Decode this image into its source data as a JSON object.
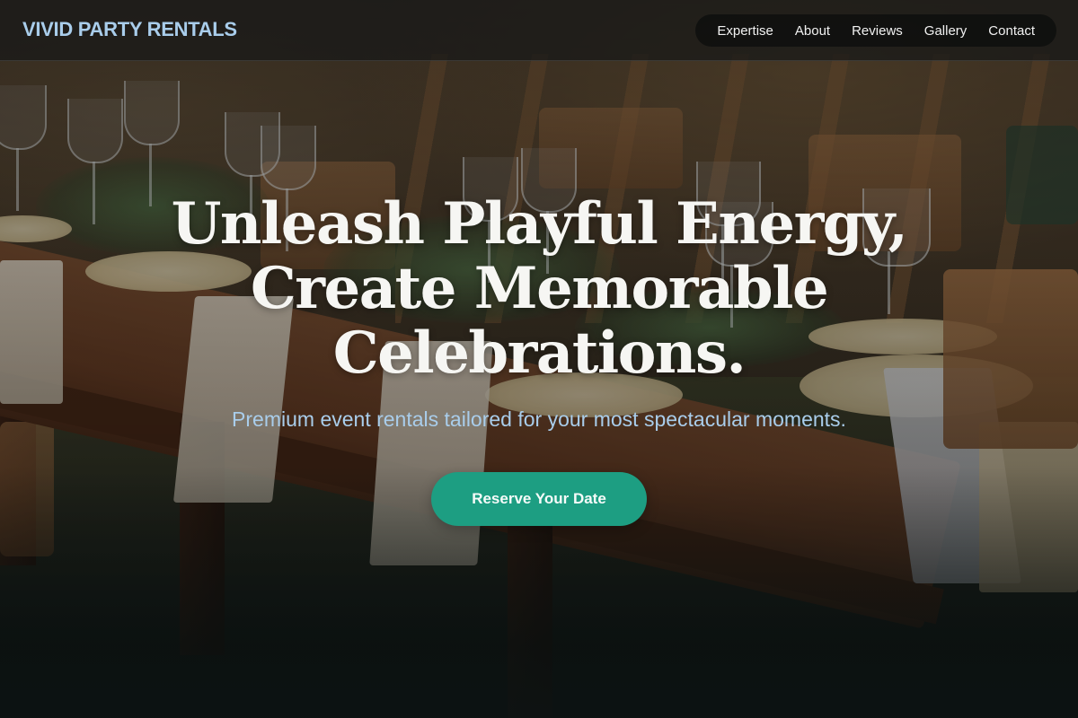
{
  "header": {
    "brand": "VIVID PARTY RENTALS",
    "nav": [
      "Expertise",
      "About",
      "Reviews",
      "Gallery",
      "Contact"
    ]
  },
  "hero": {
    "title": "Unleash Playful Energy,\nCreate Memorable\nCelebrations.",
    "subtitle": "Premium event rentals tailored for your most spectacular moments.",
    "cta_label": "Reserve Your Date"
  },
  "colors": {
    "brand": "#a9cdeb",
    "accent": "#1d9e82",
    "title": "#f6f6f3"
  }
}
